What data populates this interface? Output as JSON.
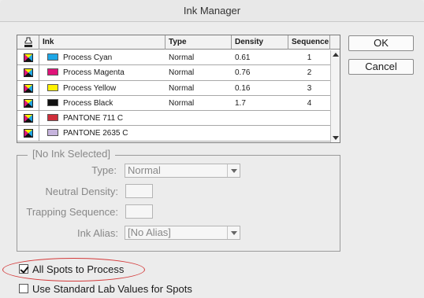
{
  "window": {
    "title": "Ink Manager"
  },
  "table": {
    "headers": {
      "ink": "Ink",
      "type": "Type",
      "density": "Density",
      "sequence": "Sequence"
    },
    "rows": [
      {
        "ink": "Process Cyan",
        "swatch": "#1ea7e6",
        "type": "Normal",
        "density": "0.61",
        "sequence": "1",
        "kind": "process"
      },
      {
        "ink": "Process Magenta",
        "swatch": "#e0147a",
        "type": "Normal",
        "density": "0.76",
        "sequence": "2",
        "kind": "process"
      },
      {
        "ink": "Process Yellow",
        "swatch": "#fff200",
        "type": "Normal",
        "density": "0.16",
        "sequence": "3",
        "kind": "process"
      },
      {
        "ink": "Process Black",
        "swatch": "#111111",
        "type": "Normal",
        "density": "1.7",
        "sequence": "4",
        "kind": "process"
      },
      {
        "ink": "PANTONE 711 C",
        "swatch": "#cf2e3a",
        "type": "",
        "density": "",
        "sequence": "",
        "kind": "spot"
      },
      {
        "ink": "PANTONE 2635 C",
        "swatch": "#c6b4dd",
        "type": "",
        "density": "",
        "sequence": "",
        "kind": "spot"
      }
    ]
  },
  "buttons": {
    "ok": "OK",
    "cancel": "Cancel"
  },
  "group": {
    "title": "[No Ink Selected]",
    "type_label": "Type:",
    "type_value": "Normal",
    "neutral_density_label": "Neutral Density:",
    "trapping_sequence_label": "Trapping Sequence:",
    "ink_alias_label": "Ink Alias:",
    "ink_alias_value": "[No Alias]"
  },
  "options": {
    "all_spots_to_process": {
      "label": "All Spots to Process",
      "checked": true
    },
    "use_standard_lab": {
      "label": "Use Standard Lab Values for Spots",
      "checked": false
    }
  },
  "colors": {
    "highlight_ellipse": "#d43a3a"
  }
}
